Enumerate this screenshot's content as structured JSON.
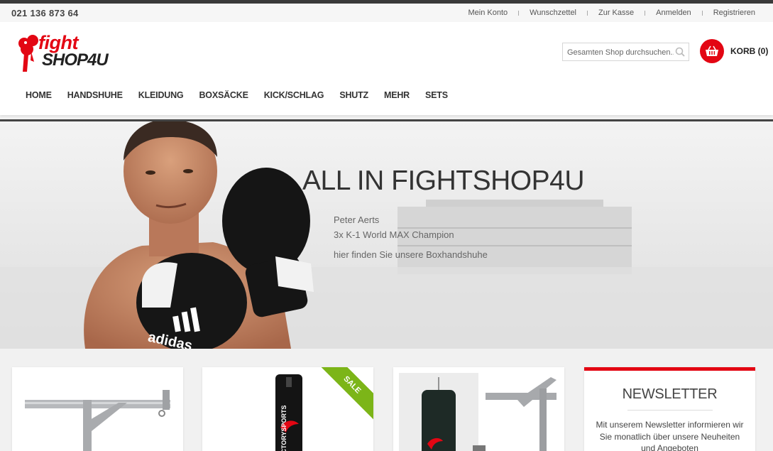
{
  "topbar": {
    "phone": "021 136 873 64",
    "links": [
      "Mein Konto",
      "Wunschzettel",
      "Zur Kasse",
      "Anmelden",
      "Registrieren"
    ]
  },
  "logo": {
    "top": "fight",
    "bottom": "SHOP4U"
  },
  "search": {
    "placeholder": "Gesamten Shop durchsuchen..."
  },
  "cart": {
    "label": "KORB (0)"
  },
  "nav": [
    "HOME",
    "HANDSHUHE",
    "KLEIDUNG",
    "BOXSÄCKE",
    "KICK/SCHLAG",
    "SHUTZ",
    "MEHR",
    "SETS"
  ],
  "hero": {
    "title": "ALL IN FIGHTSHOP4U",
    "name": "Peter Aerts",
    "subtitle": "3x K-1 World MAX Champion",
    "cta": "hier finden Sie unsere Boxhandshuhe",
    "glove_brand": "adidas"
  },
  "products": {
    "sale_label": "SALE",
    "brand": "VICTORYSPORTS"
  },
  "newsletter": {
    "title": "NEWSLETTER",
    "text": "Mit unserem Newsletter informieren wir Sie monatlich über unsere Neuheiten und Angeboten"
  },
  "colors": {
    "accent": "#e30613",
    "sale": "#7cb518"
  }
}
